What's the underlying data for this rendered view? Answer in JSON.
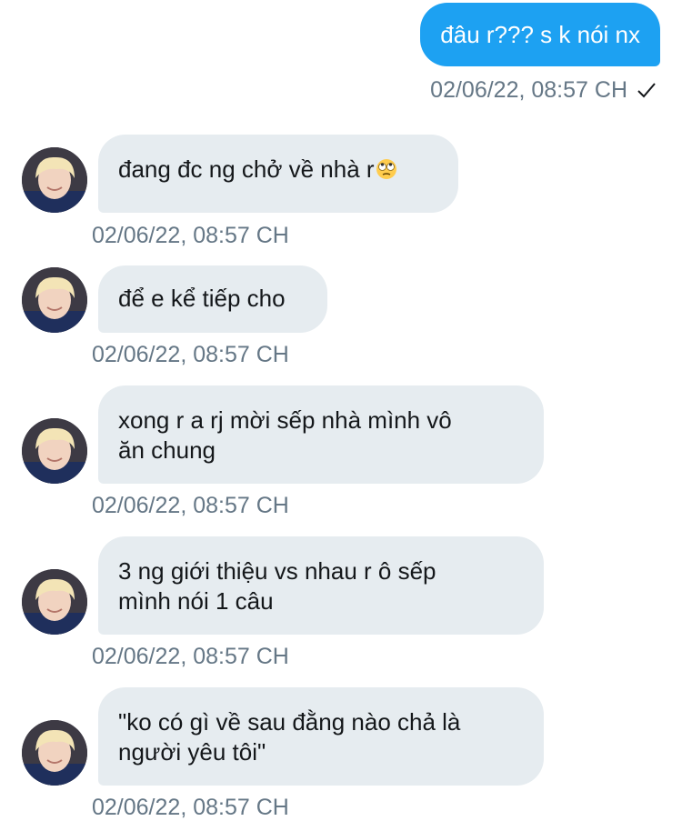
{
  "sent": {
    "text": "đâu r??? s k nói nx",
    "timestamp": "02/06/22, 08:57 CH",
    "status_icon": "checkmark-icon"
  },
  "received": [
    {
      "text": "đang đc ng chở về nhà r",
      "emoji": "face-with-rolling-eyes",
      "timestamp": "02/06/22, 08:57 CH"
    },
    {
      "text": "để e kể tiếp cho",
      "timestamp": "02/06/22, 08:57 CH"
    },
    {
      "line1": "xong r a rj mời sếp nhà mình vô",
      "line2": "ăn chung",
      "timestamp": "02/06/22, 08:57 CH"
    },
    {
      "line1": "3 ng giới thiệu vs nhau r ô sếp",
      "line2": "mình nói 1 câu",
      "timestamp": "02/06/22, 08:57 CH"
    },
    {
      "line1": "\"ko có gì về sau đằng nào chả là",
      "line2": "người yêu tôi\"",
      "timestamp": "02/06/22, 08:57 CH"
    }
  ],
  "colors": {
    "sent_bubble": "#1DA1F2",
    "received_bubble": "#E6ECF0",
    "timestamp": "#657786",
    "text": "#14171A"
  }
}
